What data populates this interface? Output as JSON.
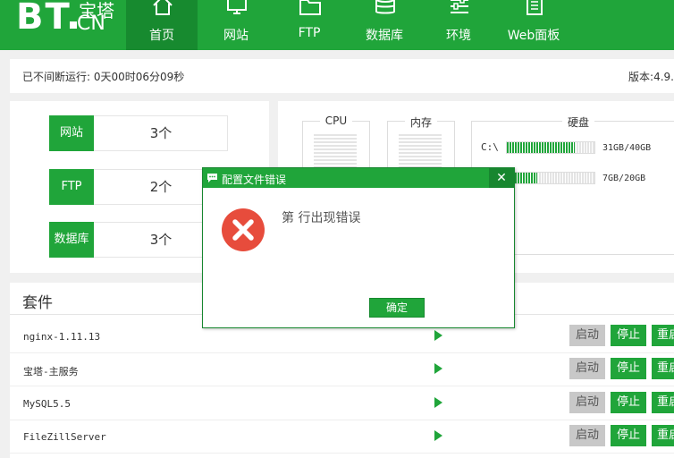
{
  "brand": {
    "logo_text": "BT",
    "site_name": "宝塔",
    "suffix": "CN"
  },
  "nav": [
    {
      "label": "首页",
      "icon": "home-icon"
    },
    {
      "label": "网站",
      "icon": "monitor-icon"
    },
    {
      "label": "FTP",
      "icon": "folder-icon"
    },
    {
      "label": "数据库",
      "icon": "database-icon"
    },
    {
      "label": "环境",
      "icon": "sliders-icon"
    },
    {
      "label": "Web面板",
      "icon": "document-icon"
    }
  ],
  "status": {
    "uptime": "已不间断运行: 0天00时06分09秒",
    "version": "版本:4.9."
  },
  "counts": [
    {
      "label": "网站",
      "value": "3个"
    },
    {
      "label": "FTP",
      "value": "2个"
    },
    {
      "label": "数据库",
      "value": "3个"
    }
  ],
  "monitor": {
    "cpu_label": "CPU",
    "memory_label": "内存",
    "disk_label": "硬盘",
    "disks": [
      {
        "name": "C:\\",
        "usage": "31GB/40GB",
        "used_fraction": 0.78
      },
      {
        "name": "",
        "usage": "7GB/20GB",
        "used_fraction": 0.35
      }
    ]
  },
  "suite": {
    "title": "套件",
    "items": [
      {
        "name": "nginx-1.11.13"
      },
      {
        "name": "宝塔-主服务"
      },
      {
        "name": "MySQL5.5"
      },
      {
        "name": "FileZillServer"
      }
    ],
    "start_label": "启动",
    "stop_label": "停止",
    "restart_label": "重启"
  },
  "dialog": {
    "title": "配置文件错误",
    "close_glyph": "✕",
    "message": "第  行出现错误",
    "ok_label": "确定"
  },
  "colors": {
    "primary": "#20a53a",
    "primary_dark": "#178a2f",
    "error": "#e74c3c"
  }
}
